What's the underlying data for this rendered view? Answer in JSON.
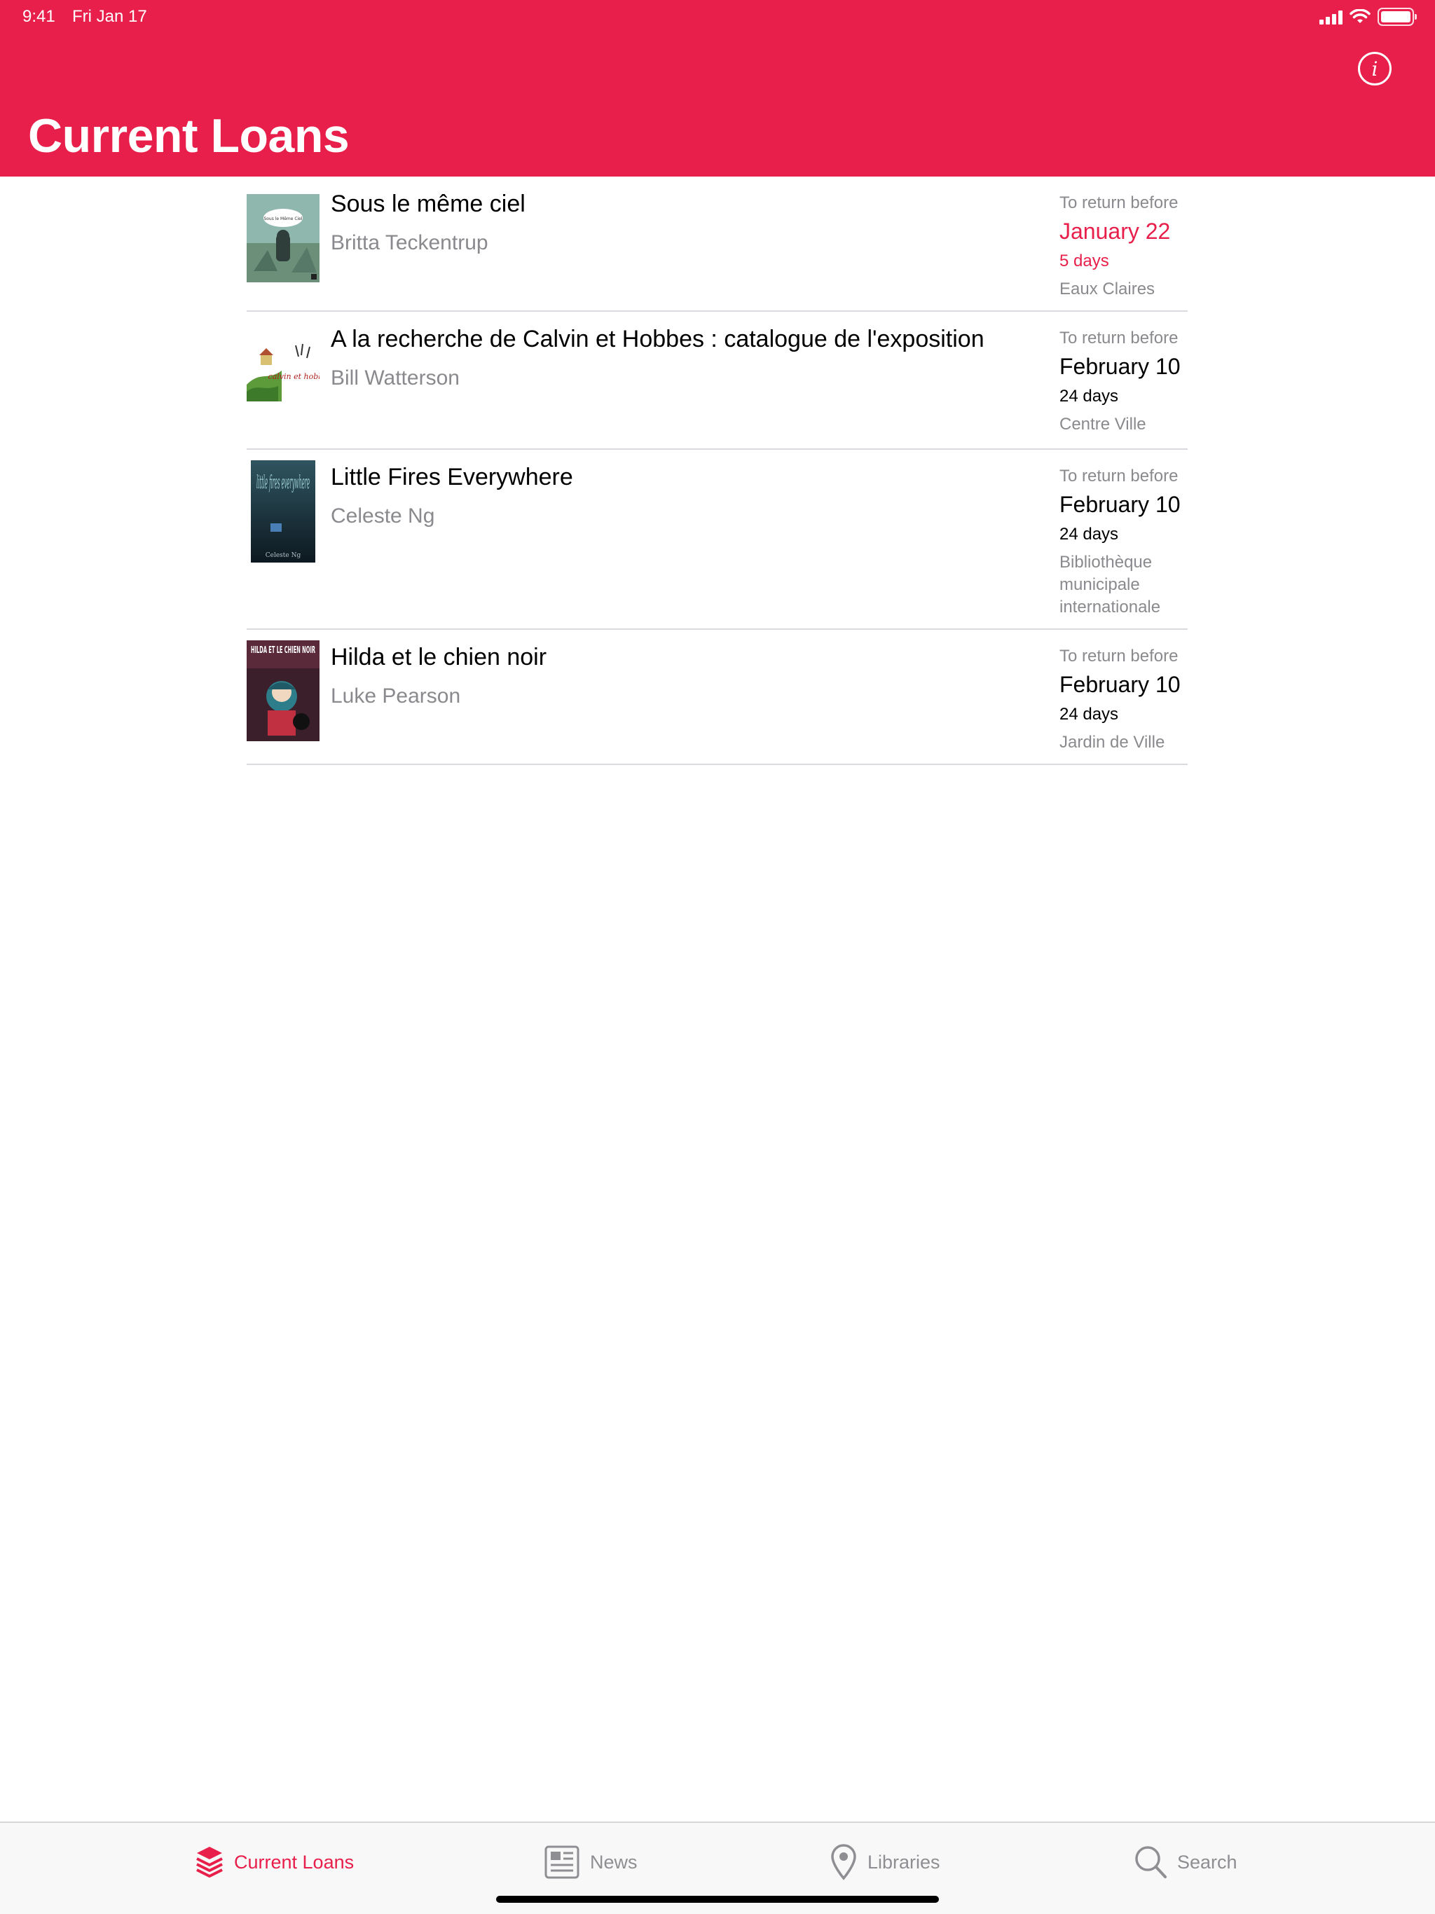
{
  "status_bar": {
    "time": "9:41",
    "date": "Fri Jan 17",
    "battery_level": 1.0
  },
  "header": {
    "title": "Current Loans",
    "info_icon": "info-circle-icon"
  },
  "colors": {
    "accent": "#e81f4a",
    "secondary_text": "#8a8a8e",
    "separator": "#d9d9de"
  },
  "loans": [
    {
      "title": "Sous le même ciel",
      "author": "Britta Teckentrup",
      "due_label": "To return before",
      "due_date": "January 22",
      "days_left": "5 days",
      "library": "Eaux Claires",
      "urgent": true,
      "cover_title": "Sous le Même Ciel"
    },
    {
      "title": "A la recherche de Calvin et Hobbes : catalogue de l'exposition",
      "author": "Bill Watterson",
      "due_label": "To return before",
      "due_date": "February 10",
      "days_left": "24 days",
      "library": "Centre Ville",
      "urgent": false,
      "cover_title": "calvin et hobbes"
    },
    {
      "title": "Little Fires Everywhere",
      "author": "Celeste Ng",
      "due_label": "To return before",
      "due_date": "February 10",
      "days_left": "24 days",
      "library": "Bibliothèque municipale internationale",
      "urgent": false,
      "cover_title": "little fires everywhere",
      "cover_author": "Celeste Ng"
    },
    {
      "title": "Hilda et le chien noir",
      "author": "Luke Pearson",
      "due_label": "To return before",
      "due_date": "February 10",
      "days_left": "24 days",
      "library": "Jardin de Ville",
      "urgent": false,
      "cover_title": "HILDA ET LE CHIEN NOIR"
    }
  ],
  "tab_bar": {
    "tabs": [
      {
        "label": "Current Loans",
        "icon": "book-stack-icon",
        "active": true
      },
      {
        "label": "News",
        "icon": "newspaper-icon",
        "active": false
      },
      {
        "label": "Libraries",
        "icon": "map-pin-icon",
        "active": false
      },
      {
        "label": "Search",
        "icon": "magnifier-icon",
        "active": false
      }
    ]
  }
}
